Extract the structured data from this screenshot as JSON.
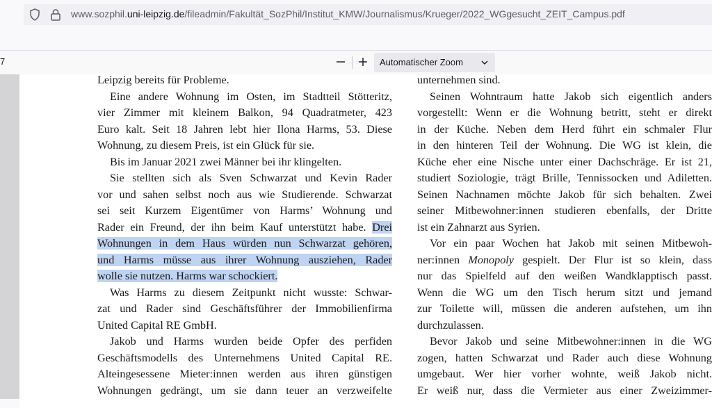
{
  "address_bar": {
    "url_prefix": "www.sozphil.",
    "url_domain": "uni-leipzig.de",
    "url_path": "/fileadmin/Fakultät_SozPhil/Institut_KMW/Journalismus/Krueger/2022_WGgesucht_ZEIT_Campus.pdf"
  },
  "pdf_toolbar": {
    "page_number": "7",
    "zoom_out_symbol": "—",
    "zoom_in_symbol": "+",
    "zoom_label": "Automatischer Zoom"
  },
  "document": {
    "left_column": [
      {
        "text": "Leipzig bereits für Probleme.",
        "indent": false,
        "last": true
      },
      {
        "text": "Eine andere Wohnung im Osten, im Stadtteil Stötteritz,",
        "indent": true,
        "last": false
      },
      {
        "text": "vier Zimmer mit kleinem Balkon, 94 Quadratmeter, 423",
        "indent": false,
        "last": false
      },
      {
        "text": "Euro kalt. Seit 18 Jahren lebt hier Ilona Harms, 53. Diese",
        "indent": false,
        "last": false
      },
      {
        "text": "Wohnung, zu diesem Preis, ist ein Glück für sie.",
        "indent": false,
        "last": true
      },
      {
        "text": "Bis im Januar 2021 zwei Männer bei ihr klingelten.",
        "indent": true,
        "last": true
      },
      {
        "text": "Sie stellten sich als Sven Schwarzat und Kevin Rader",
        "indent": true,
        "last": false
      },
      {
        "text": "vor und sahen selbst noch aus wie Studierende. Schwarzat",
        "indent": false,
        "last": false
      },
      {
        "text": "sei seit Kurzem Eigentümer von Harms’ Wohnung und",
        "indent": false,
        "last": false
      },
      {
        "text": "Rader ein Freund, der ihn beim Kauf unterstützt habe. ",
        "highlight": "Drei",
        "indent": false,
        "last": false
      },
      {
        "text": "",
        "highlight": "Wohnungen in dem Haus würden nun Schwarzat gehören,",
        "indent": false,
        "last": false
      },
      {
        "text": "",
        "highlight": "und Harms müsse aus ihrer Wohnung ausziehen, Rader",
        "indent": false,
        "last": false
      },
      {
        "text": "",
        "highlight": "wolle sie nutzen. Harms war schockiert.",
        "indent": false,
        "last": true
      },
      {
        "text": "Was Harms zu diesem Zeitpunkt nicht wusste: Schwar-",
        "indent": true,
        "last": false
      },
      {
        "text": "zat und Rader sind Geschäftsführer der Immobilienfirma",
        "indent": false,
        "last": false
      },
      {
        "text": "United Capital RE GmbH.",
        "indent": false,
        "last": true
      },
      {
        "text": "Jakob und Harms wurden beide Opfer des perfiden",
        "indent": true,
        "last": false
      },
      {
        "text": "Geschäftsmodells des Unternehmens United Capital RE.",
        "indent": false,
        "last": false
      },
      {
        "text": "Alteingesessene Mieter:innen werden aus ihren günstigen",
        "indent": false,
        "last": false
      },
      {
        "text": "Wohnungen gedrängt, um sie dann teuer an verzweifelte",
        "indent": false,
        "last": false
      }
    ],
    "right_column": [
      {
        "text": "unternehmen sind.",
        "indent": false,
        "last": true
      },
      {
        "text": "Seinen Wohntraum hatte Jakob sich eigentlich anders",
        "indent": true,
        "last": false
      },
      {
        "text": "vorgestellt: Wenn er die Wohnung betritt, steht er direkt",
        "indent": false,
        "last": false
      },
      {
        "text": "in der Küche. Neben dem Herd führt ein schmaler Flur",
        "indent": false,
        "last": false
      },
      {
        "text": "in den hinteren Teil der Wohnung. Die WG ist klein, die",
        "indent": false,
        "last": false
      },
      {
        "text": "Küche eher eine Nische unter einer Dachschräge. Er ist 21,",
        "indent": false,
        "last": false
      },
      {
        "text": "studiert Soziologie, trägt Brille, Tennissocken und Adiletten.",
        "indent": false,
        "last": false
      },
      {
        "text": "Seinen Nachnamen möchte Jakob für sich behalten. Zwei",
        "indent": false,
        "last": false
      },
      {
        "text": "seiner Mitbewohner:innen studieren ebenfalls, der Dritte",
        "indent": false,
        "last": false
      },
      {
        "text": "ist ein Zahnarzt aus Syrien.",
        "indent": false,
        "last": true
      },
      {
        "text": "Vor ein paar Wochen hat Jakob mit seinen Mitbewoh-",
        "indent": true,
        "last": false
      },
      {
        "text": "ner:innen ",
        "italic": "Monopoly",
        "after": " gespielt. Der Flur ist so klein, dass",
        "indent": false,
        "last": false
      },
      {
        "text": "nur das Spielfeld auf den weißen Wandklapptisch passt.",
        "indent": false,
        "last": false
      },
      {
        "text": "Wenn die WG um den Tisch herum sitzt und jemand",
        "indent": false,
        "last": false
      },
      {
        "text": "zur Toilette will, müssen die anderen aufstehen, um ihn",
        "indent": false,
        "last": false
      },
      {
        "text": "durchzulassen.",
        "indent": false,
        "last": true
      },
      {
        "text": "Bevor Jakob und seine Mitbewohner:innen in die WG",
        "indent": true,
        "last": false
      },
      {
        "text": "zogen, hatten Schwarzat und Rader auch diese Wohnung",
        "indent": false,
        "last": false
      },
      {
        "text": "umgebaut. Wer hier vorher wohnte, weiß Jakob nicht.",
        "indent": false,
        "last": false
      },
      {
        "text": "Er weiß nur, dass die Vermieter aus einer Zweizimmer-",
        "indent": false,
        "last": false
      }
    ]
  },
  "colors": {
    "highlight": "#bfd4f2",
    "viewer_background": "#d4d4d7"
  }
}
